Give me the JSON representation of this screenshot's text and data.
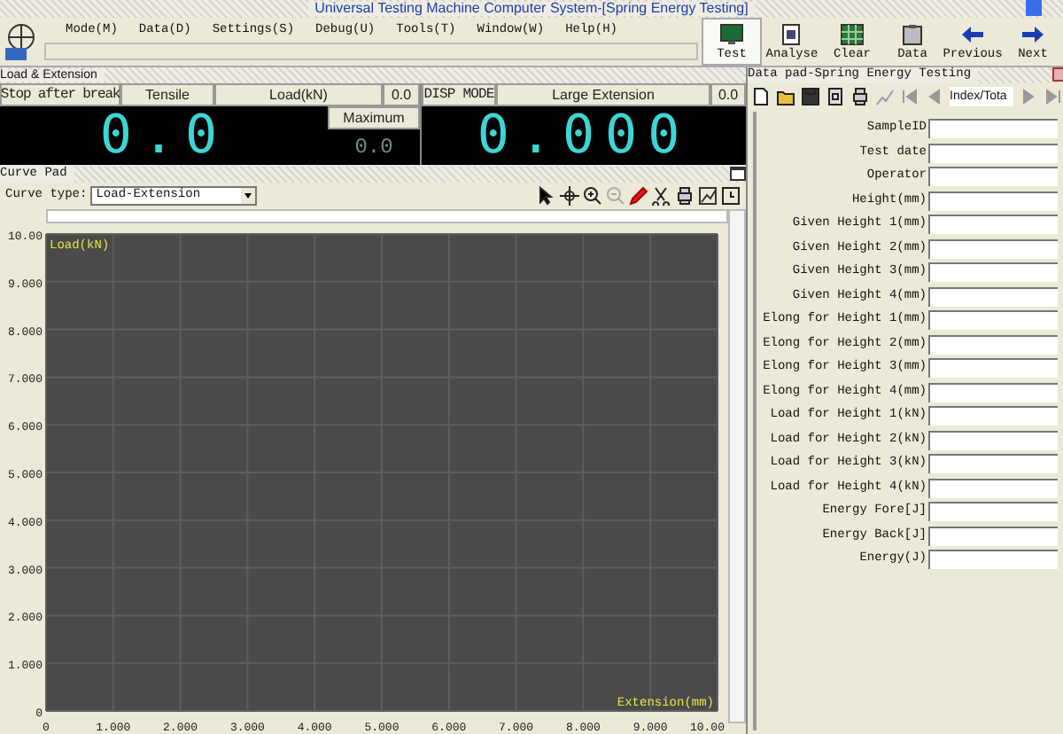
{
  "window": {
    "title": "Universal Testing Machine Computer System-[Spring Energy Testing]"
  },
  "menu": [
    "Mode(M)",
    "Data(D)",
    "Settings(S)",
    "Debug(U)",
    "Tools(T)",
    "Window(W)",
    "Help(H)"
  ],
  "toolbar": [
    {
      "label": "Test",
      "selected": true
    },
    {
      "label": "Analyse",
      "selected": false
    },
    {
      "label": "Clear",
      "selected": false
    },
    {
      "label": "Data",
      "selected": false
    },
    {
      "label": "Previous",
      "selected": false
    },
    {
      "label": "Next",
      "selected": false
    }
  ],
  "load_panel": {
    "title": "Load & Extension",
    "stop_mode": "Stop after break",
    "test_mode": "Tensile",
    "load_label": "Load(kN)",
    "load_reading": "0.0",
    "disp_mode": "DISP MODE",
    "ext_label": "Large Extension",
    "ext_reading": "0.0",
    "load_value": "0.0",
    "maximum_label": "Maximum",
    "maximum_value": "0.0",
    "ext_value": "0.000"
  },
  "curve_pad": {
    "title": "Curve Pad",
    "curve_type_label": "Curve type:",
    "curve_type": "Load-Extension",
    "chart_data": {
      "type": "line",
      "grid": true,
      "xlabel": "Extension(mm)",
      "ylabel": "Load(kN)",
      "xlim": [
        0,
        10
      ],
      "ylim": [
        0,
        10
      ],
      "xticks": [
        {
          "value": 0,
          "label": "0"
        },
        {
          "value": 1,
          "label": "1.000"
        },
        {
          "value": 2,
          "label": "2.000"
        },
        {
          "value": 3,
          "label": "3.000"
        },
        {
          "value": 4,
          "label": "4.000"
        },
        {
          "value": 5,
          "label": "5.000"
        },
        {
          "value": 6,
          "label": "6.000"
        },
        {
          "value": 7,
          "label": "7.000"
        },
        {
          "value": 8,
          "label": "8.000"
        },
        {
          "value": 9,
          "label": "9.000"
        },
        {
          "value": 10,
          "label": "10.00"
        }
      ],
      "yticks": [
        {
          "value": 0,
          "label": "0"
        },
        {
          "value": 1,
          "label": "1.000"
        },
        {
          "value": 2,
          "label": "2.000"
        },
        {
          "value": 3,
          "label": "3.000"
        },
        {
          "value": 4,
          "label": "4.000"
        },
        {
          "value": 5,
          "label": "5.000"
        },
        {
          "value": 6,
          "label": "6.000"
        },
        {
          "value": 7,
          "label": "7.000"
        },
        {
          "value": 8,
          "label": "8.000"
        },
        {
          "value": 9,
          "label": "9.000"
        },
        {
          "value": 10,
          "label": "10.00"
        }
      ]
    }
  },
  "data_pad": {
    "title": "Data pad-Spring Energy Testing",
    "record_field": "Index/Tota",
    "fields": [
      "SampleID",
      "Test date",
      "Operator",
      "Height(mm)",
      "Given Height 1(mm)",
      "Given Height 2(mm)",
      "Given Height 3(mm)",
      "Given Height 4(mm)",
      "Elong for Height 1(mm)",
      "Elong for Height 2(mm)",
      "Elong for Height 3(mm)",
      "Elong for Height 4(mm)",
      "Load for Height 1(kN)",
      "Load for Height 2(kN)",
      "Load for Height 3(kN)",
      "Load for Height 4(kN)",
      "Energy Fore[J]",
      "Energy Back[J]",
      "Energy(J)"
    ]
  }
}
